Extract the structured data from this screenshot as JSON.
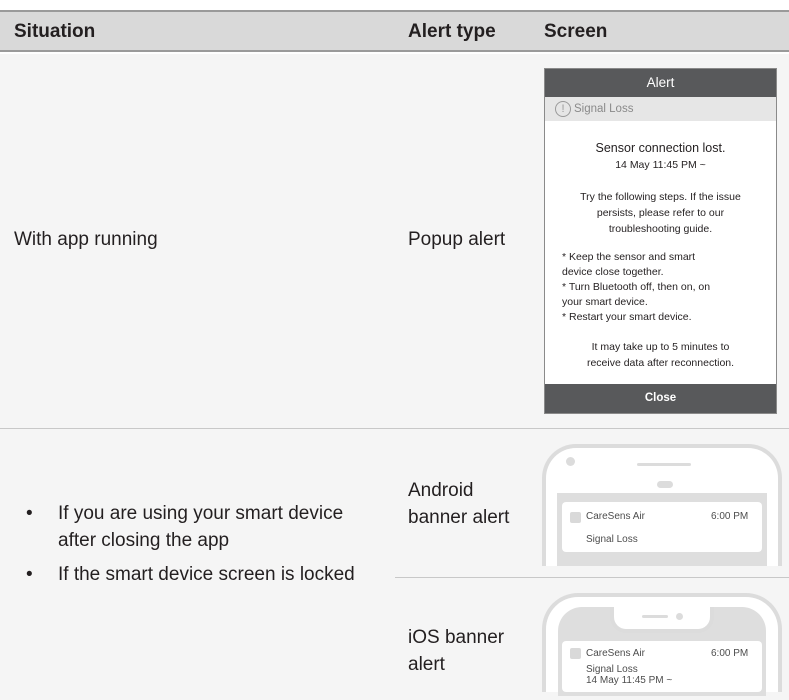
{
  "header": {
    "situation": "Situation",
    "alert_type": "Alert type",
    "screen": "Screen"
  },
  "row1": {
    "situation": "With app running",
    "alert_type": "Popup alert",
    "popup": {
      "title": "Alert",
      "subtitle": "Signal Loss",
      "headline": "Sensor connection lost.",
      "timestamp": "14 May  11:45 PM ~",
      "instructions": [
        "Try the following steps. If the issue",
        "persists, please refer to our",
        "troubleshooting guide."
      ],
      "steps": [
        "* Keep the sensor and smart",
        "device close together.",
        "* Turn Bluetooth off, then on, on",
        "your smart device.",
        "* Restart your smart device."
      ],
      "note": [
        "It may take up to 5 minutes to",
        "receive data after reconnection."
      ],
      "close_label": "Close"
    }
  },
  "row2": {
    "situations": [
      "If you are using your smart device after closing the app",
      "If the smart device screen is locked"
    ],
    "android": {
      "alert_type_line1": "Android",
      "alert_type_line2": "banner alert",
      "app_name": "CareSens Air",
      "time": "6:00 PM",
      "message": "Signal Loss"
    },
    "ios": {
      "alert_type_line1": "iOS banner",
      "alert_type_line2": "alert",
      "app_name": "CareSens Air",
      "time": "6:00 PM",
      "message": "Signal Loss",
      "timestamp": "14 May  11:45 PM ~"
    }
  }
}
